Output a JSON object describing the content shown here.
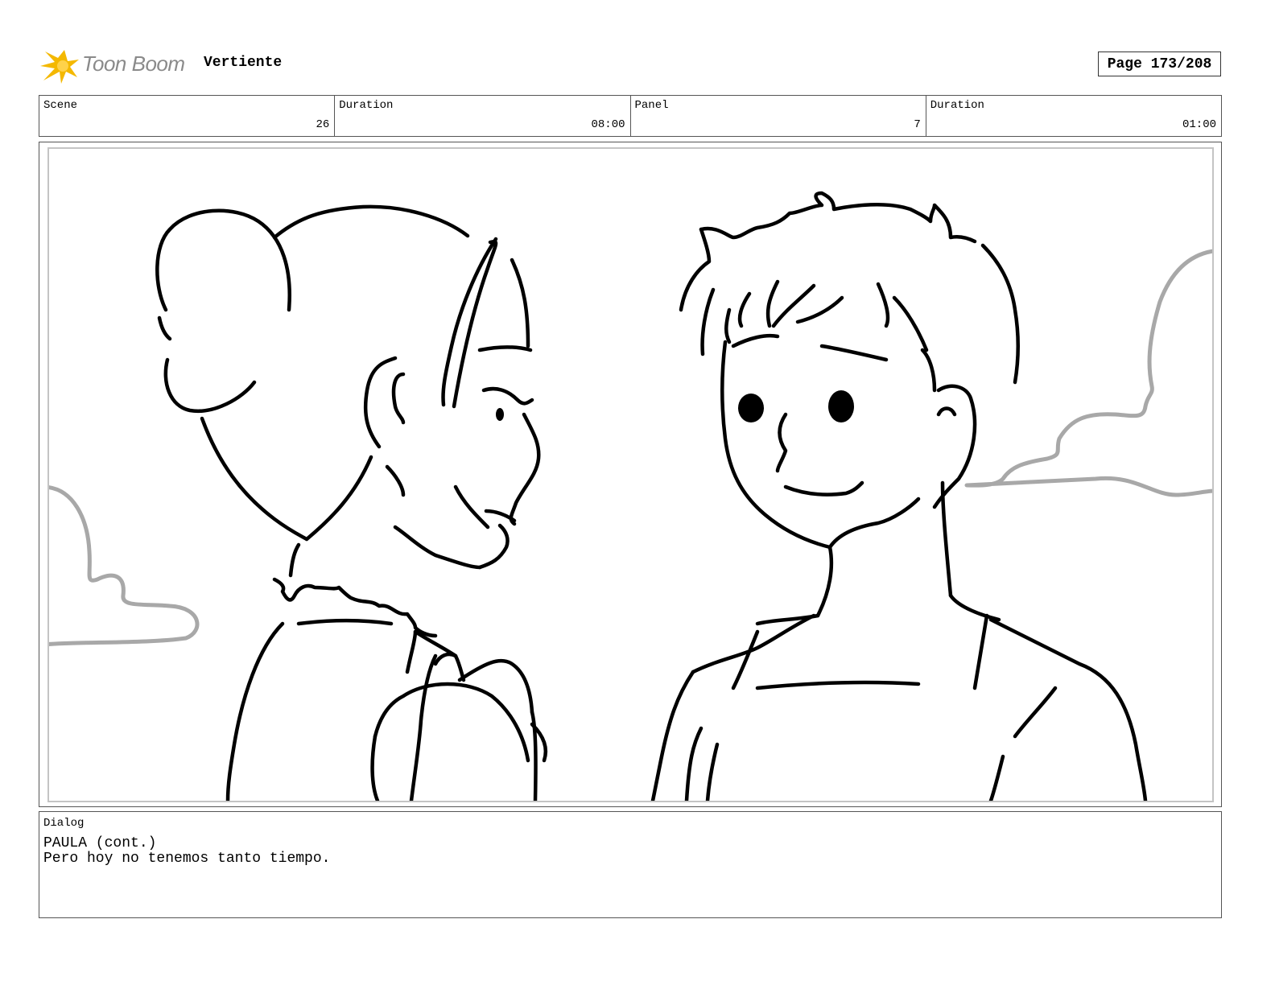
{
  "header": {
    "logo_text": "Toon Boom",
    "project_title": "Vertiente",
    "page_label": "Page 173/208"
  },
  "info": {
    "scene_label": "Scene",
    "scene_value": "26",
    "scene_duration_label": "Duration",
    "scene_duration_value": "08:00",
    "panel_label": "Panel",
    "panel_value": "7",
    "panel_duration_label": "Duration",
    "panel_duration_value": "01:00"
  },
  "dialog": {
    "label": "Dialog",
    "line1": "PAULA (cont.)",
    "line2": "Pero hoy no tenemos tanto tiempo."
  },
  "colors": {
    "logo_star": "#f4b800",
    "logo_text": "#8a8a8a",
    "cloud_stroke": "#a8a8a8",
    "ink": "#000000"
  }
}
